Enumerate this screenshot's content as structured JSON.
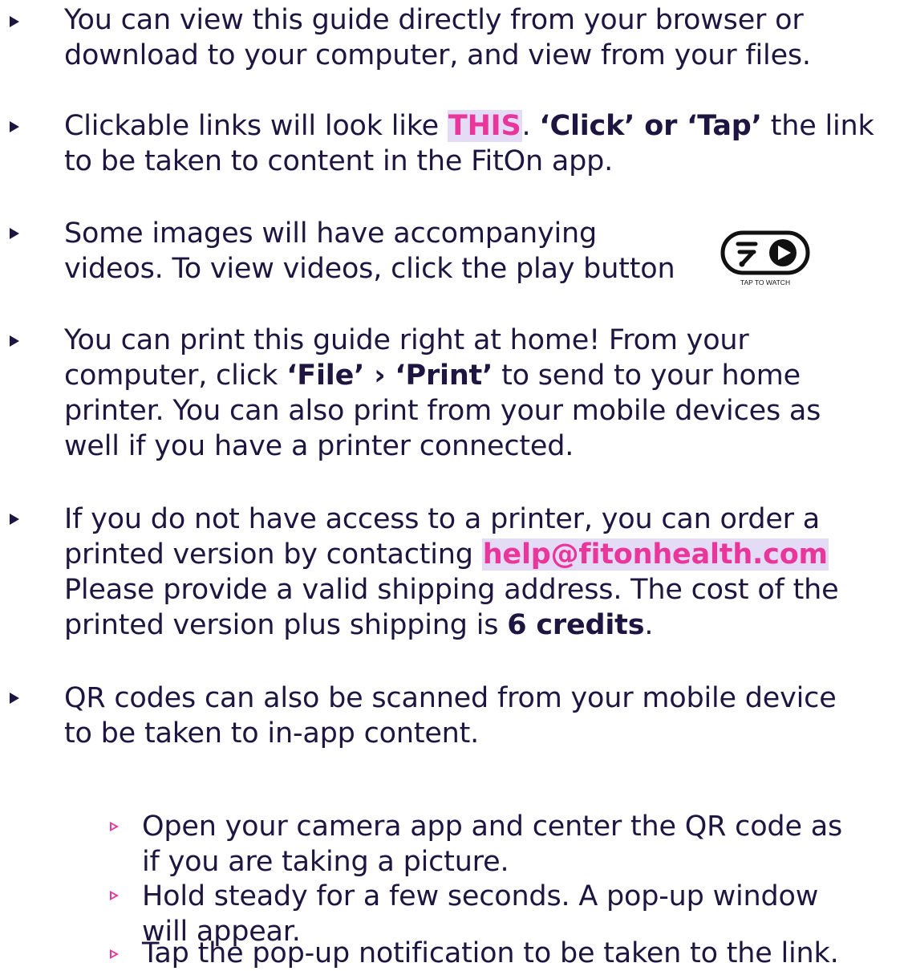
{
  "bullets": {
    "b1": {
      "line1": "You can view this guide directly from your browser or",
      "line2": "download to your computer, and view from your files."
    },
    "b2": {
      "prefix": "Clickable links will look like ",
      "link": "THIS",
      "after_link": ". ",
      "bold": "‘Click’ or ‘Tap’",
      "suffix": " the link",
      "line2": "to be taken to content in the FitOn app."
    },
    "b3": {
      "line1": "Some images will have accompanying",
      "line2": "videos. To view videos, click the play button",
      "badge_label": "TAP TO WATCH"
    },
    "b4": {
      "line1": "You can print this guide right at home! From your",
      "line2_prefix": "computer, click ",
      "line2_bold": "‘File’ › ‘Print’",
      "line2_suffix": " to send to your home",
      "line3": "printer. You can also print from your mobile devices as",
      "line4": "well if you have a printer connected."
    },
    "b5": {
      "line1": "If you do not have access to a printer, you can order a",
      "line2_prefix": "printed version by contacting ",
      "email": "help@fitonhealth.com",
      "line3": "Please provide a valid shipping address. The cost of the",
      "line4_prefix": "printed version plus shipping is ",
      "line4_bold": "6 credits",
      "line4_suffix": "."
    },
    "b6": {
      "line1": "QR codes can also be scanned from your mobile device",
      "line2": "to be taken to in-app content."
    }
  },
  "sub_bullets": [
    {
      "line1": "Open your camera app and center the QR code as",
      "line2": "if you are taking a picture."
    },
    {
      "line1": "Hold steady for a few seconds. A pop-up window",
      "line2": "will appear."
    },
    {
      "line1": "Tap the pop-up notification to be taken to the link."
    }
  ],
  "colors": {
    "text": "#1e1541",
    "accent": "#e8369a",
    "highlight_bg": "#e4dcf6"
  },
  "icons": {
    "watch_badge": "tap-to-watch-play-icon"
  }
}
